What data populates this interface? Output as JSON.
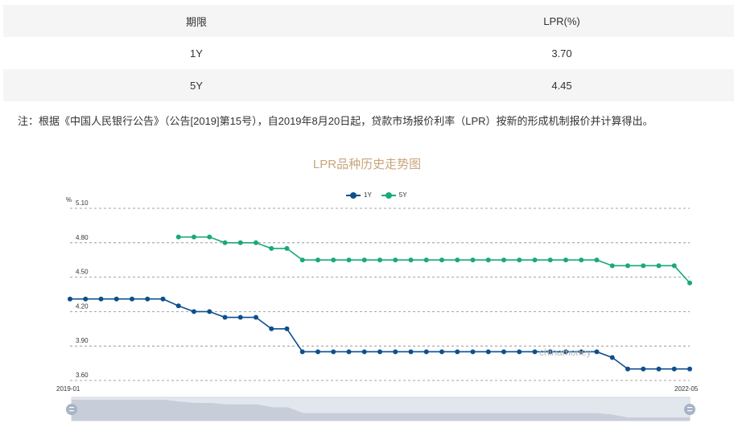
{
  "table": {
    "headers": [
      "期限",
      "LPR(%)"
    ],
    "rows": [
      {
        "term": "1Y",
        "rate": "3.70"
      },
      {
        "term": "5Y",
        "rate": "4.45"
      }
    ]
  },
  "note": "注：根据《中国人民银行公告》（公告[2019]第15号），自2019年8月20日起，贷款市场报价利率（LPR）按新的形成机制报价并计算得出。",
  "watermark": "chinamoney",
  "colors": {
    "series_1y": "#0e4f8c",
    "series_5y": "#19aa77",
    "title": "#c9a57a",
    "grid": "#888888",
    "slider_fill": "#d8dde7",
    "slider_handle": "#a7b3c6"
  },
  "chart_data": {
    "type": "line",
    "title": "LPR品种历史走势图",
    "ylabel": "%",
    "ylim": [
      3.6,
      5.1
    ],
    "yticks": [
      "5.10",
      "4.80",
      "4.50",
      "4.20",
      "3.90",
      "3.60"
    ],
    "x_start_label": "2019-01",
    "x_end_label": "2022-05",
    "legend_position": "top-center",
    "grid": true,
    "series": [
      {
        "name": "1Y",
        "values": [
          4.31,
          4.31,
          4.31,
          4.31,
          4.31,
          4.31,
          4.31,
          4.25,
          4.2,
          4.2,
          4.15,
          4.15,
          4.15,
          4.05,
          4.05,
          3.85,
          3.85,
          3.85,
          3.85,
          3.85,
          3.85,
          3.85,
          3.85,
          3.85,
          3.85,
          3.85,
          3.85,
          3.85,
          3.85,
          3.85,
          3.85,
          3.85,
          3.85,
          3.85,
          3.85,
          3.8,
          3.7,
          3.7,
          3.7,
          3.7,
          3.7
        ]
      },
      {
        "name": "5Y",
        "values": [
          null,
          null,
          null,
          null,
          null,
          null,
          null,
          4.85,
          4.85,
          4.85,
          4.8,
          4.8,
          4.8,
          4.75,
          4.75,
          4.65,
          4.65,
          4.65,
          4.65,
          4.65,
          4.65,
          4.65,
          4.65,
          4.65,
          4.65,
          4.65,
          4.65,
          4.65,
          4.65,
          4.65,
          4.65,
          4.65,
          4.65,
          4.65,
          4.65,
          4.6,
          4.6,
          4.6,
          4.6,
          4.6,
          4.45
        ]
      }
    ]
  }
}
